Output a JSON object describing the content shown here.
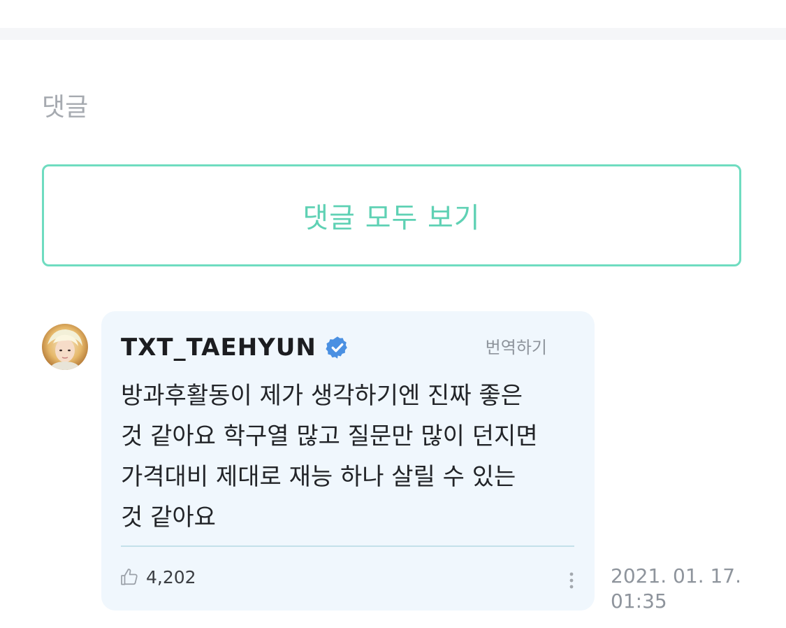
{
  "section": {
    "title": "댓글"
  },
  "view_all": {
    "label": "댓글 모두 보기"
  },
  "comment": {
    "author": "TXT_TAEHYUN",
    "translate_label": "번역하기",
    "body": "방과후활동이 제가 생각하기엔 진짜 좋은\n것 같아요 학구열 많고 질문만 많이 던지면\n가격대비 제대로 재능 하나 살릴 수 있는\n것 같아요",
    "likes": "4,202",
    "timestamp": "2021. 01. 17.\n01:35"
  },
  "icons": {
    "verified": "verified-check-icon",
    "like": "thumbs-up-icon",
    "more": "more-vertical-icon"
  },
  "colors": {
    "accent": "#5fd1b4",
    "accent_border": "#6fdcc0",
    "bubble_bg": "#f0f7fd",
    "verified_blue": "#4a90e2",
    "muted_text": "#8e949c"
  }
}
